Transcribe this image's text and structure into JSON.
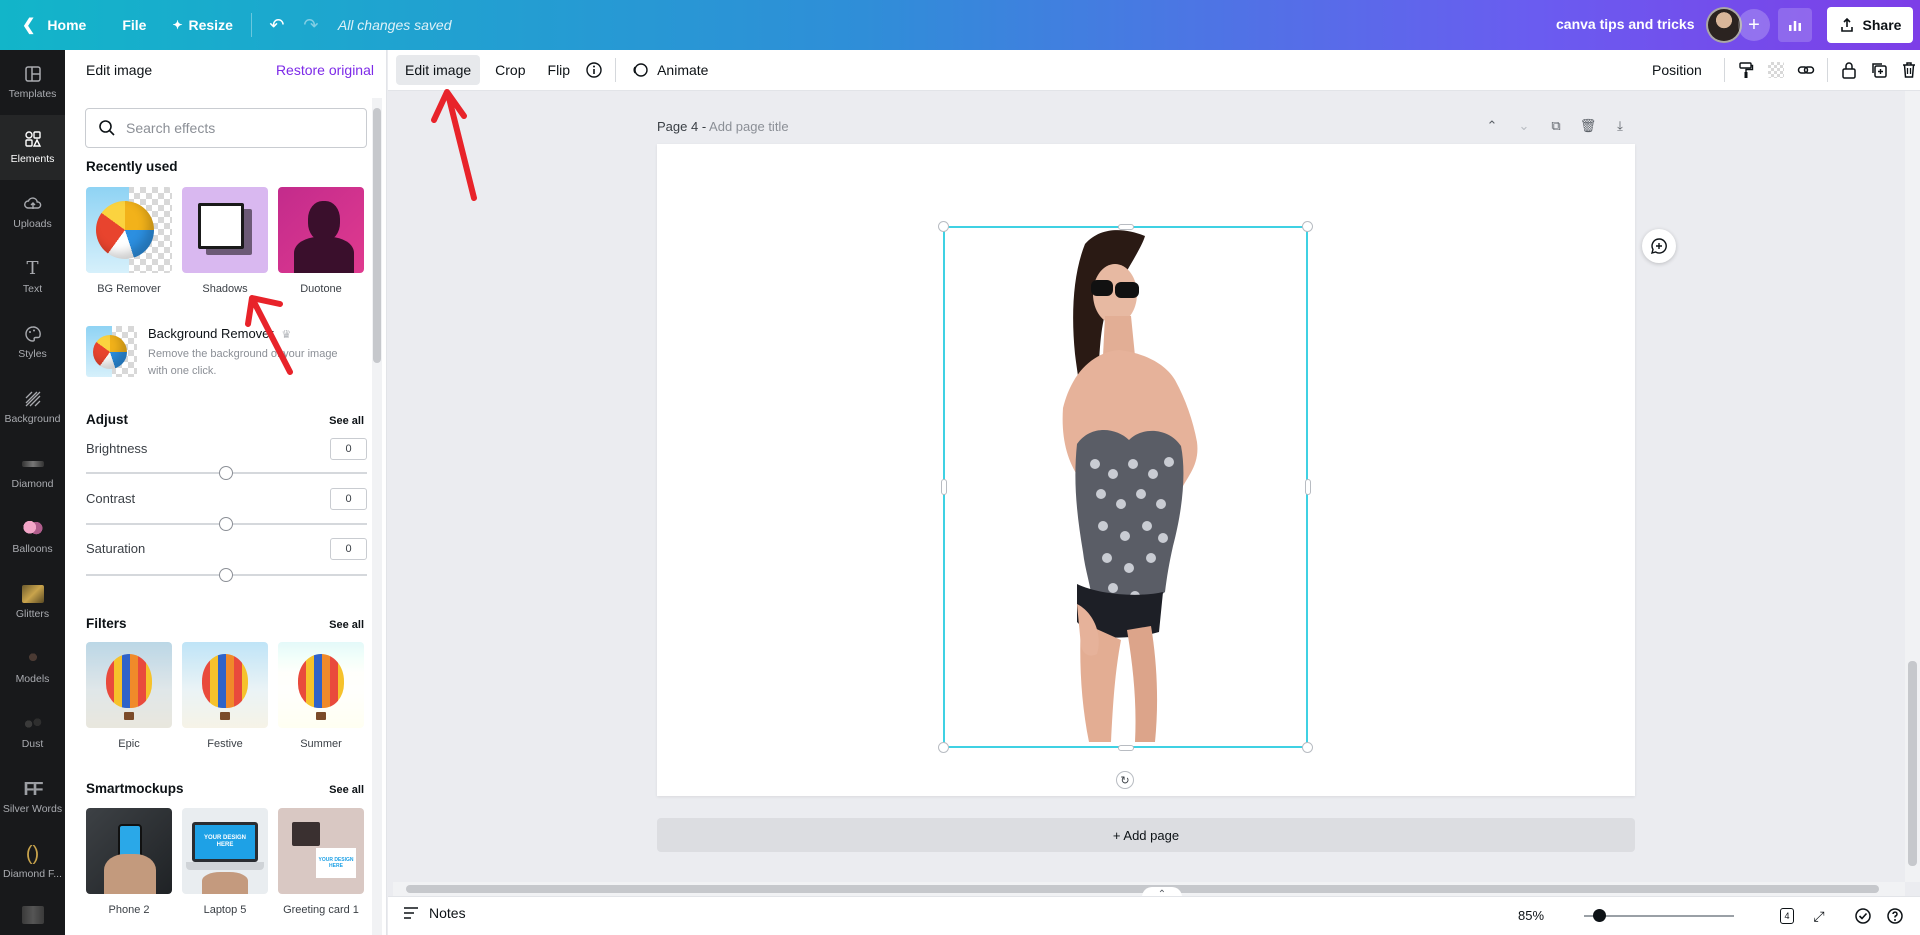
{
  "topbar": {
    "home_label": "Home",
    "file_label": "File",
    "resize_label": "Resize",
    "saved_status": "All changes saved",
    "design_title": "canva tips and tricks",
    "share_label": "Share"
  },
  "rail": {
    "items": [
      {
        "label": "Templates",
        "icon": "templates-icon"
      },
      {
        "label": "Elements",
        "icon": "elements-icon"
      },
      {
        "label": "Uploads",
        "icon": "uploads-icon"
      },
      {
        "label": "Text",
        "icon": "text-icon"
      },
      {
        "label": "Styles",
        "icon": "styles-icon"
      },
      {
        "label": "Background",
        "icon": "background-icon"
      },
      {
        "label": "Diamond",
        "icon": "diamond-icon"
      },
      {
        "label": "Balloons",
        "icon": "balloons-icon"
      },
      {
        "label": "Glitters",
        "icon": "glitters-icon"
      },
      {
        "label": "Models",
        "icon": "models-icon"
      },
      {
        "label": "Dust",
        "icon": "dust-icon"
      },
      {
        "label": "Silver Words",
        "icon": "silver-words-icon"
      },
      {
        "label": "Diamond F...",
        "icon": "diamond-frame-icon"
      }
    ],
    "active": "Elements"
  },
  "panel": {
    "title": "Edit image",
    "restore_label": "Restore original",
    "search_placeholder": "Search effects",
    "recently_used": {
      "title": "Recently used",
      "items": [
        "BG Remover",
        "Shadows",
        "Duotone"
      ]
    },
    "bg_remover": {
      "title": "Background Remover",
      "description": "Remove the background of your image with one click."
    },
    "adjust": {
      "title": "Adjust",
      "see_all": "See all",
      "controls": [
        {
          "label": "Brightness",
          "value": "0"
        },
        {
          "label": "Contrast",
          "value": "0"
        },
        {
          "label": "Saturation",
          "value": "0"
        }
      ]
    },
    "filters": {
      "title": "Filters",
      "see_all": "See all",
      "items": [
        "Epic",
        "Festive",
        "Summer"
      ]
    },
    "smartmockups": {
      "title": "Smartmockups",
      "see_all": "See all",
      "items": [
        "Phone 2",
        "Laptop 5",
        "Greeting card 1"
      ],
      "mockup_text": "YOUR DESIGN HERE"
    }
  },
  "context_toolbar": {
    "edit_image": "Edit image",
    "crop": "Crop",
    "flip": "Flip",
    "animate": "Animate",
    "position": "Position"
  },
  "canvas": {
    "page_name": "Page 4 - ",
    "page_title_placeholder": "Add page title",
    "add_page": "+ Add page"
  },
  "bottombar": {
    "notes": "Notes",
    "zoom": "85%",
    "zoom_fraction": 0.1,
    "page_count": "4"
  },
  "colors": {
    "accent": "#7d2ae8",
    "selection": "#3fd1e3",
    "annotation": "#e8232a"
  }
}
